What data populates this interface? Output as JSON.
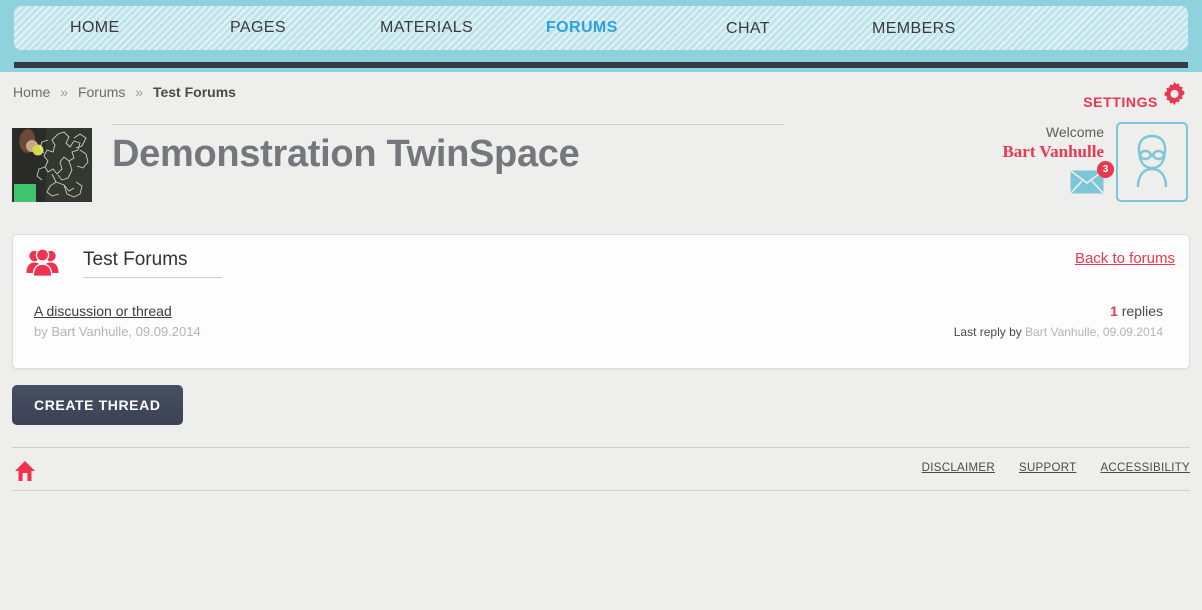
{
  "nav": {
    "items": [
      {
        "label": "HOME",
        "name": "nav-home",
        "active": false
      },
      {
        "label": "PAGES",
        "name": "nav-pages",
        "active": false
      },
      {
        "label": "MATERIALS",
        "name": "nav-materials",
        "active": false
      },
      {
        "label": "FORUMS",
        "name": "nav-forums",
        "active": true
      },
      {
        "label": "CHAT",
        "name": "nav-chat",
        "active": false
      },
      {
        "label": "MEMBERS",
        "name": "nav-members",
        "active": false
      }
    ]
  },
  "breadcrumb": {
    "home": "Home",
    "sep": "»",
    "forums": "Forums",
    "current": "Test Forums"
  },
  "settings": {
    "label": "SETTINGS",
    "icon": "gear-icon",
    "color": "#e8384f"
  },
  "space": {
    "title": "Demonstration TwinSpace",
    "thumbnail_alt": "chalkboard-europe-map"
  },
  "user": {
    "welcome": "Welcome",
    "name": "Bart Vanhulle",
    "messages_count": "3",
    "mail_icon": "envelope-icon",
    "avatar_icon": "user-avatar-icon"
  },
  "forum": {
    "icon": "group-icon",
    "heading": "Test Forums",
    "back_link": "Back to forums",
    "threads": [
      {
        "title": "A discussion or thread",
        "meta": "by Bart Vanhulle, 09.09.2014",
        "replies_count": "1",
        "replies_label": "replies",
        "last_reply_prefix": "Last reply by",
        "last_reply_author": "Bart Vanhulle",
        "last_reply_date": ", 09.09.2014"
      }
    ]
  },
  "actions": {
    "create_thread": "CREATE THREAD"
  },
  "footer": {
    "home_icon": "home-icon",
    "links": [
      {
        "label": "DISCLAIMER",
        "name": "footer-link-disclaimer"
      },
      {
        "label": "SUPPORT",
        "name": "footer-link-support"
      },
      {
        "label": "ACCESSIBILITY",
        "name": "footer-link-accessibility"
      }
    ]
  },
  "colors": {
    "header_teal": "#8ed2de",
    "nav_panel": "#bfe4ec",
    "accent_red": "#e8384f",
    "active_blue": "#2ea1dd",
    "dark_rule": "#333a45",
    "page_bg": "#eeeeec"
  }
}
